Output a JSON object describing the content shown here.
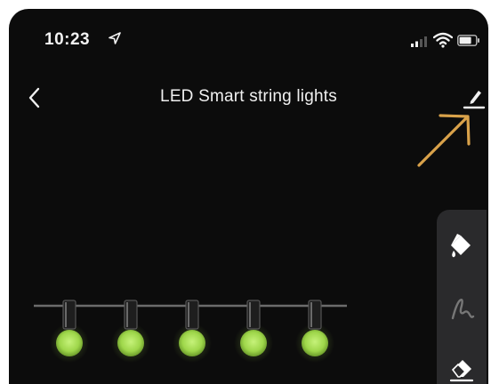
{
  "status_bar": {
    "time": "10:23",
    "icons": [
      "location-arrow-icon",
      "cellular-signal-icon",
      "wifi-icon",
      "battery-icon"
    ]
  },
  "nav": {
    "back_icon": "chevron-left-icon",
    "title": "LED Smart string lights",
    "edit_icon": "pencil-edit-icon"
  },
  "annotation": {
    "icon": "arrow-pointer-annotation",
    "color": "#d9a24a"
  },
  "tools": [
    {
      "name": "paint-bucket-icon",
      "state": "active"
    },
    {
      "name": "brush-stroke-icon",
      "state": "inactive"
    },
    {
      "name": "eraser-icon",
      "state": "active"
    }
  ],
  "bulbs": {
    "count": 5,
    "color": "#9ed64a",
    "icon": "light-bulb-icon"
  },
  "colors": {
    "background": "#0c0c0c",
    "panel": "#2a2a2c",
    "text": "#f0f0f0",
    "bulb": "#9ed64a",
    "arrow": "#d9a24a"
  }
}
